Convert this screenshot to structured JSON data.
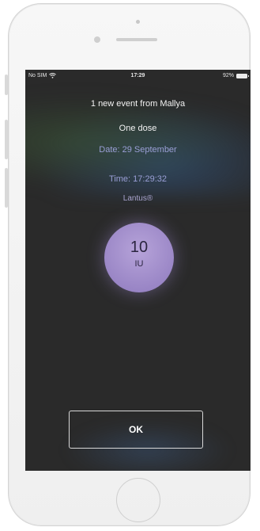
{
  "status_bar": {
    "carrier": "No SIM",
    "wifi_icon": "wifi-icon",
    "time": "17:29",
    "battery_percent": "92%",
    "battery_icon": "battery-icon"
  },
  "notification": {
    "title": "1 new event from Mallya",
    "dose_type": "One dose",
    "date": "Date: 29 September",
    "time": "Time: 17:29:32",
    "medication": "Lantus®",
    "dose_value": "10",
    "dose_unit": "IU",
    "ok_label": "OK"
  },
  "colors": {
    "accent_purple": "#9a86c6",
    "date_text": "#9a9fd6",
    "background": "#2a2a2a"
  }
}
